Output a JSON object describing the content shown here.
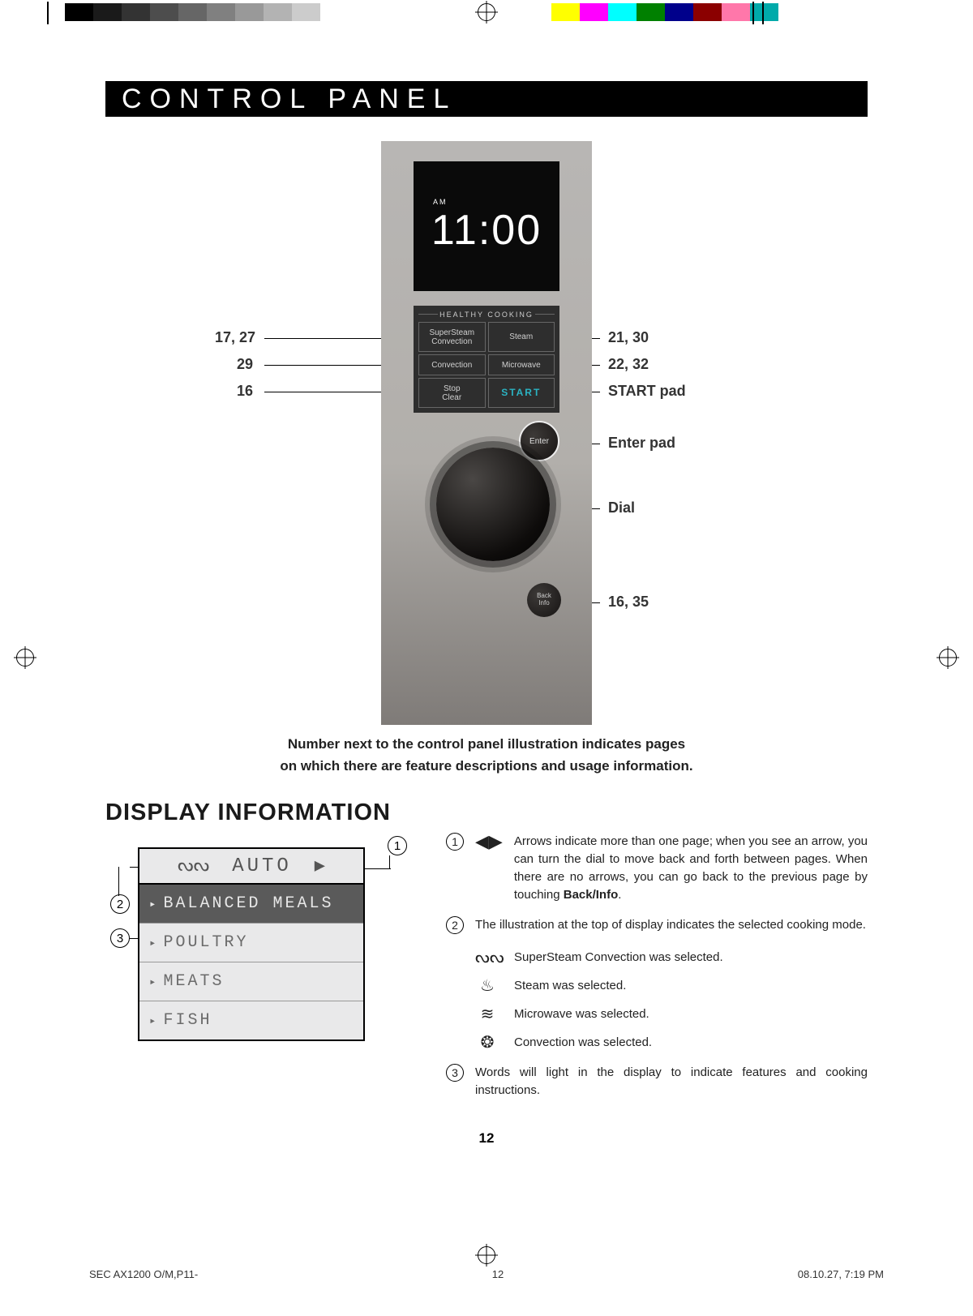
{
  "section_title": "CONTROL PANEL",
  "panel": {
    "screen": {
      "am": "AM",
      "time": "11:00"
    },
    "grid_header": "HEALTHY  COOKING",
    "btn_supersteam": "SuperSteam\nConvection",
    "btn_steam": "Steam",
    "btn_convection": "Convection",
    "btn_microwave": "Microwave",
    "btn_stop": "Stop\nClear",
    "btn_start": "START",
    "enter": "Enter",
    "back_top": "Back",
    "back_bottom": "Info"
  },
  "callouts": {
    "l1": "17, 27",
    "l2": "29",
    "l3": "16",
    "r1": "21, 30",
    "r2": "22, 32",
    "r3": "START pad",
    "r4": "Enter pad",
    "r5": "Dial",
    "r6": "16, 35"
  },
  "panel_caption_1": "Number next to the control panel illustration indicates pages",
  "panel_caption_2": "on which there are feature descriptions and usage information.",
  "display_heading": "DISPLAY INFORMATION",
  "disp_screen": {
    "auto": "AUTO",
    "items": [
      "BALANCED MEALS",
      "POULTRY",
      "MEATS",
      "FISH"
    ]
  },
  "info": {
    "i1": "Arrows indicate more than one page; when you see an arrow, you can turn the dial to move back and forth between pages. When there are no arrows, you can go back to the previous page by touching ",
    "i1_bold": "Back/Info",
    "i1_tail": ".",
    "i2": "The illustration at the top of display indicates the selected cooking mode.",
    "modes": {
      "m1": "SuperSteam Convection was selected.",
      "m2": "Steam was selected.",
      "m3": "Microwave was selected.",
      "m4": "Convection was selected."
    },
    "i3": "Words will light in the display to indicate features and cooking instructions."
  },
  "circles": {
    "c1": "1",
    "c2": "2",
    "c3": "3"
  },
  "page_number": "12",
  "slug": {
    "left": "SEC AX1200 O/M,P11-",
    "center": "12",
    "right": "08.10.27, 7:19 PM"
  },
  "color_bar_left": [
    "#000",
    "#1a1a1a",
    "#333",
    "#4d4d4d",
    "#666",
    "#808080",
    "#999",
    "#b3b3b3",
    "#ccc"
  ],
  "color_bar_right": [
    "#ff0",
    "#f0f",
    "#0ff",
    "#008000",
    "#00008b",
    "#8b0000",
    "#f7a",
    "#0aa",
    "#fff"
  ]
}
